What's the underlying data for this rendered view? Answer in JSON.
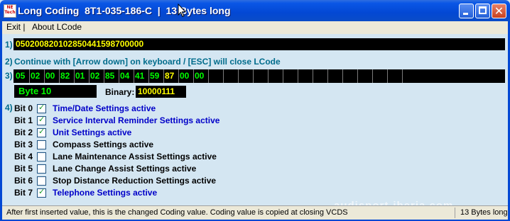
{
  "window": {
    "title": "Long Coding  8T1-035-186-C  |  13 Bytes long",
    "icon_text": "NE\nTech",
    "buttons": {
      "minimize": "minimize",
      "maximize": "maximize",
      "close": "✕"
    }
  },
  "menu": {
    "items": [
      "Exit |",
      "About LCode"
    ]
  },
  "steps": {
    "s1": "1)",
    "s2": "2)",
    "s3": "3)",
    "s4": "4)"
  },
  "coding_value": "050200820102850441598700000",
  "hint": "Continue with [Arrow down] on keyboard / [ESC] will close LCode",
  "bytes": [
    {
      "value": "05",
      "color": "#00ff00"
    },
    {
      "value": "02",
      "color": "#00ff00"
    },
    {
      "value": "00",
      "color": "#00ff00"
    },
    {
      "value": "82",
      "color": "#00ff00"
    },
    {
      "value": "01",
      "color": "#00ff00"
    },
    {
      "value": "02",
      "color": "#00ff00"
    },
    {
      "value": "85",
      "color": "#00ff00"
    },
    {
      "value": "04",
      "color": "#00ff00"
    },
    {
      "value": "41",
      "color": "#00ff00"
    },
    {
      "value": "59",
      "color": "#00ff00"
    },
    {
      "value": "87",
      "color": "#ffff00"
    },
    {
      "value": "00",
      "color": "#00ff00"
    },
    {
      "value": "00",
      "color": "#00ff00"
    }
  ],
  "total_cells": 27,
  "selected_byte": "Byte 10",
  "binary": {
    "label": "Binary:",
    "value": "10000111"
  },
  "bits": [
    {
      "label": "Bit 0",
      "checked": true,
      "text": "Time/Date Settings active"
    },
    {
      "label": "Bit 1",
      "checked": true,
      "text": "Service Interval Reminder Settings active"
    },
    {
      "label": "Bit 2",
      "checked": true,
      "text": "Unit Settings active"
    },
    {
      "label": "Bit 3",
      "checked": false,
      "text": "Compass Settings active"
    },
    {
      "label": "Bit 4",
      "checked": false,
      "text": "Lane Maintenance Assist Settings active"
    },
    {
      "label": "Bit 5",
      "checked": false,
      "text": "Lane Change Assist Settings active"
    },
    {
      "label": "Bit 6",
      "checked": false,
      "text": "Stop Distance Reduction Settings active"
    },
    {
      "label": "Bit 7",
      "checked": true,
      "text": "Telephone Settings active"
    }
  ],
  "status": {
    "left": "After first inserted value, this is the changed Coding value.  Coding value is copied at closing VCDS",
    "right": "13 Bytes long"
  },
  "watermark": "audisport-iberia.com",
  "colors": {
    "title_bar": "#0348d4",
    "client_bg": "#d4e6f2",
    "step_color": "#006c8c",
    "checked_text": "#0000c8"
  }
}
